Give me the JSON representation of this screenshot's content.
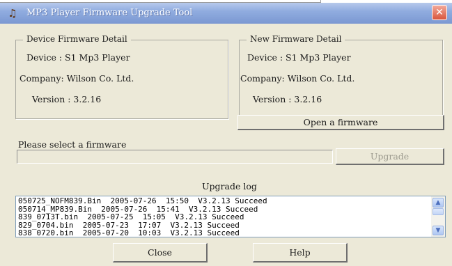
{
  "window": {
    "title": "MP3 Player Firmware Upgrade Tool",
    "close_glyph": "✕"
  },
  "device_firmware": {
    "group_title": "Device Firmware Detail",
    "device": "Device : S1 Mp3 Player",
    "company": "Company: Wilson Co. Ltd.",
    "version": "Version : 3.2.16"
  },
  "new_firmware": {
    "group_title": "New Firmware Detail",
    "device": "Device : S1 Mp3 Player",
    "company": "Company: Wilson Co. Ltd.",
    "version": "Version : 3.2.16",
    "open_button": "Open a firmware"
  },
  "select": {
    "label": "Please select a firmware",
    "path_value": "",
    "upgrade_button": "Upgrade"
  },
  "log": {
    "title": "Upgrade log",
    "lines": [
      "050725_NOFM839.Bin  2005-07-26  15:50  V3.2.13 Succeed",
      "050714_MP839.Bin  2005-07-26  15:41  V3.2.13 Succeed",
      "839_0713T.bin  2005-07-25  15:05  V3.2.13 Succeed",
      "829_0704.bin  2005-07-23  17:07  V3.2.13 Succeed",
      "838_0720.bin  2005-07-20  10:03  V3.2.13 Succeed"
    ]
  },
  "buttons": {
    "close": "Close",
    "help": "Help"
  },
  "icons": {
    "app": "mp3-player-icon",
    "scroll_up": "scroll-up-icon",
    "scroll_down": "scroll-down-icon"
  }
}
